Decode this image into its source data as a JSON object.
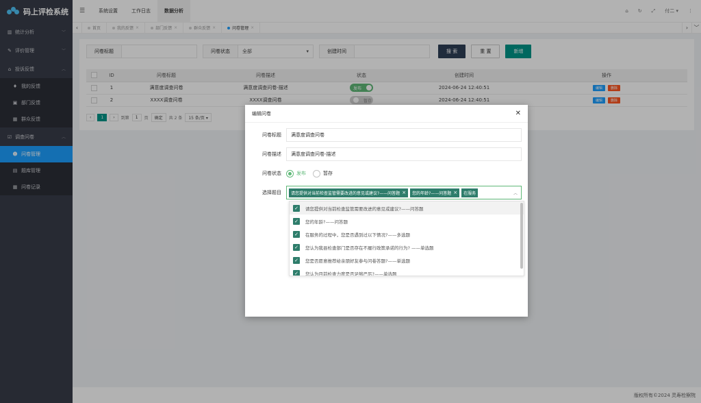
{
  "app": {
    "title": "码上评检系统"
  },
  "sidebar": {
    "groups": [
      {
        "label": "统计分析",
        "icon": "bar-chart-icon"
      },
      {
        "label": "评价管理",
        "icon": "wrench-icon"
      },
      {
        "label": "投诉反馈",
        "icon": "bank-icon"
      }
    ],
    "complaint_items": [
      {
        "label": "我的反馈"
      },
      {
        "label": "部门反馈"
      },
      {
        "label": "群众反馈"
      }
    ],
    "survey_group": {
      "label": "调查问卷"
    },
    "survey_items": [
      {
        "label": "问卷管理"
      },
      {
        "label": "题库管理"
      },
      {
        "label": "问卷记录"
      }
    ]
  },
  "topnav": {
    "items": [
      "系统设置",
      "工作日志",
      "数据分析"
    ],
    "user": "付二"
  },
  "tabs": [
    {
      "label": "首页"
    },
    {
      "label": "我的反馈"
    },
    {
      "label": "部门反馈"
    },
    {
      "label": "群众反馈"
    },
    {
      "label": "问卷管理"
    }
  ],
  "filters": {
    "title_label": "问卷标题",
    "status_label": "问卷状态",
    "status_value": "全部",
    "created_label": "创建时间",
    "search_btn": "搜 索",
    "reset_btn": "重 置",
    "add_btn": "新增"
  },
  "table": {
    "headers": [
      "ID",
      "问卷标题",
      "问卷描述",
      "状态",
      "创建时间",
      "操作"
    ],
    "rows": [
      {
        "id": "1",
        "title": "满意度调查问卷",
        "desc": "满意度调查问卷-描述",
        "status": "发布",
        "created": "2024-06-24 12:40:51"
      },
      {
        "id": "2",
        "title": "XXXX调查问卷",
        "desc": "XXXX调查问卷",
        "status": "暂存",
        "created": "2024-06-24 12:40:51"
      }
    ],
    "edit_label": "编辑",
    "delete_label": "删除"
  },
  "pager": {
    "current": "1",
    "goto_prefix": "到第",
    "goto_value": "1",
    "page_unit": "页",
    "confirm": "确定",
    "total": "共 2 条",
    "page_size": "15 条/页"
  },
  "footer": {
    "text": "版权所有©2024 灵寿检察院"
  },
  "dialog": {
    "title": "编辑问卷",
    "title_label": "问卷标题",
    "title_value": "满意度调查问卷",
    "desc_label": "问卷描述",
    "desc_value": "满意度调查问卷-描述",
    "status_label": "问卷状态",
    "status_options": [
      "发布",
      "暂存"
    ],
    "status_selected": "发布",
    "questions_label": "选择题目",
    "selected_tags": [
      "请您提供对当前检查监管需要改进的意见或建议?——问答题",
      "您的年龄?——问答题",
      "在服务"
    ],
    "options": [
      "请您提供对当前检查监管需要改进的意见或建议?——问答题",
      "您的年龄?——问答题",
      "在服务的过程中，您是否遇到过以下情况?——多选题",
      "您认为我县检查部门是否存在不履行政策承诺的行为? ——单选题",
      "您是否愿意推荐给亲朋好友参与问卷答题?——单选题",
      "您认为目前检查力度是否足够严厉?——单选题"
    ]
  }
}
